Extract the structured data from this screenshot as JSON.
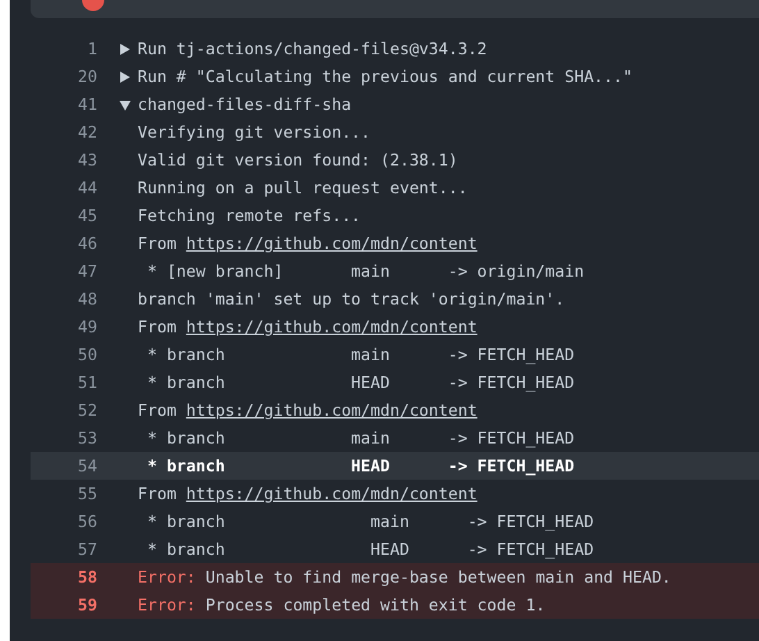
{
  "step": {
    "failed": true
  },
  "lines": [
    {
      "number": "1",
      "kind": "group",
      "expanded": false,
      "highlighted": false,
      "text": "Run tj-actions/changed-files@v34.3.2"
    },
    {
      "number": "20",
      "kind": "group",
      "expanded": false,
      "highlighted": false,
      "text": "Run # \"Calculating the previous and current SHA...\""
    },
    {
      "number": "41",
      "kind": "group",
      "expanded": true,
      "highlighted": false,
      "text": "changed-files-diff-sha"
    },
    {
      "number": "42",
      "kind": "text",
      "highlighted": false,
      "text": "Verifying git version..."
    },
    {
      "number": "43",
      "kind": "text",
      "highlighted": false,
      "text": "Valid git version found: (2.38.1)"
    },
    {
      "number": "44",
      "kind": "text",
      "highlighted": false,
      "text": "Running on a pull request event..."
    },
    {
      "number": "45",
      "kind": "text",
      "highlighted": false,
      "text": "Fetching remote refs..."
    },
    {
      "number": "46",
      "kind": "link",
      "highlighted": false,
      "text": "From ",
      "url": "https://github.com/mdn/content"
    },
    {
      "number": "47",
      "kind": "text",
      "highlighted": false,
      "text": " * [new branch]       main      -> origin/main"
    },
    {
      "number": "48",
      "kind": "text",
      "highlighted": false,
      "text": "branch 'main' set up to track 'origin/main'."
    },
    {
      "number": "49",
      "kind": "link",
      "highlighted": false,
      "text": "From ",
      "url": "https://github.com/mdn/content"
    },
    {
      "number": "50",
      "kind": "text",
      "highlighted": false,
      "text": " * branch             main      -> FETCH_HEAD"
    },
    {
      "number": "51",
      "kind": "text",
      "highlighted": false,
      "text": " * branch             HEAD      -> FETCH_HEAD"
    },
    {
      "number": "52",
      "kind": "link",
      "highlighted": false,
      "text": "From ",
      "url": "https://github.com/mdn/content"
    },
    {
      "number": "53",
      "kind": "text",
      "highlighted": false,
      "text": " * branch             main      -> FETCH_HEAD"
    },
    {
      "number": "54",
      "kind": "text",
      "highlighted": true,
      "text": " * branch             HEAD      -> FETCH_HEAD"
    },
    {
      "number": "55",
      "kind": "link",
      "highlighted": false,
      "text": "From ",
      "url": "https://github.com/mdn/content"
    },
    {
      "number": "56",
      "kind": "text",
      "highlighted": false,
      "text": " * branch               main      -> FETCH_HEAD"
    },
    {
      "number": "57",
      "kind": "text",
      "highlighted": false,
      "text": " * branch               HEAD      -> FETCH_HEAD"
    },
    {
      "number": "58",
      "kind": "error",
      "highlighted": false,
      "label": "Error:",
      "text": " Unable to find merge-base between main and HEAD."
    },
    {
      "number": "59",
      "kind": "error",
      "highlighted": false,
      "label": "Error:",
      "text": " Process completed with exit code 1."
    }
  ]
}
